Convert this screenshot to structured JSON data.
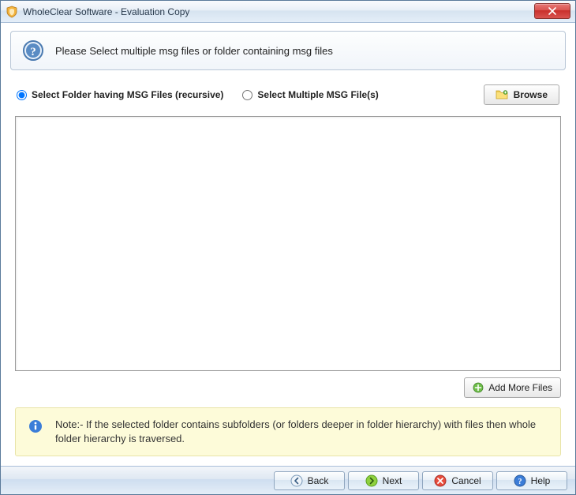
{
  "window": {
    "title": "WholeClear Software - Evaluation Copy"
  },
  "header": {
    "instruction": "Please Select multiple msg files or folder containing msg files"
  },
  "options": {
    "folder_label": "Select Folder having MSG Files (recursive)",
    "files_label": "Select Multiple MSG File(s)",
    "selected": "folder",
    "browse_label": "Browse"
  },
  "add_more_label": "Add More Files",
  "note": {
    "text": "Note:- If the selected folder contains subfolders (or folders deeper in folder hierarchy) with files then whole folder hierarchy is traversed."
  },
  "footer": {
    "back": "Back",
    "next": "Next",
    "cancel": "Cancel",
    "help": "Help"
  }
}
